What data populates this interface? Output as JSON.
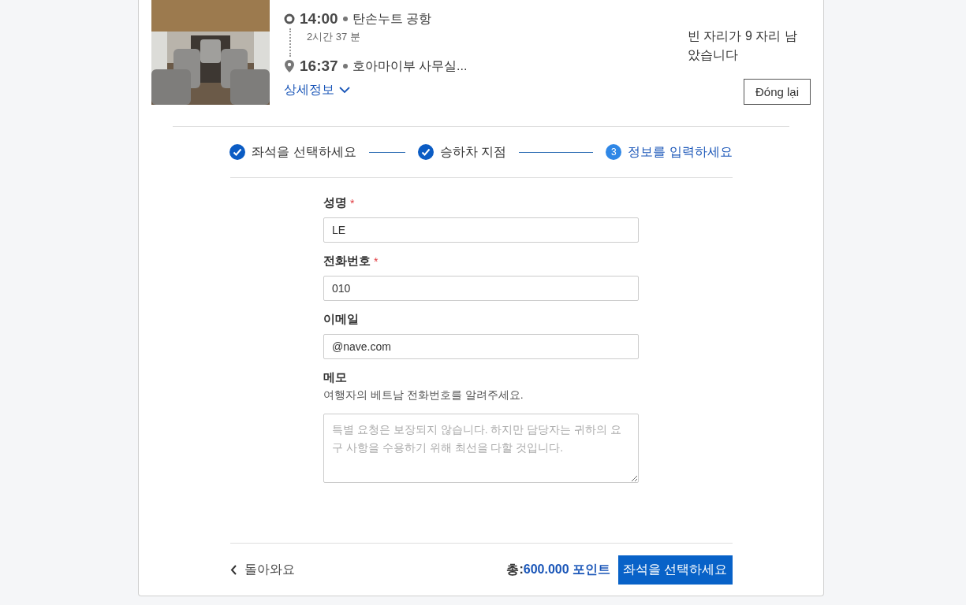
{
  "trip": {
    "departure": {
      "time": "14:00",
      "place": "탄손누트 공항"
    },
    "duration": "2시간 37 분",
    "arrival": {
      "time": "16:37",
      "place": "호아마이부 사무실..."
    },
    "details_link": "상세정보",
    "seats_left": "빈 자리가 9 자리 남았습니다",
    "close_button": "Đóng lại"
  },
  "steps": [
    {
      "label": "좌석을 선택하세요",
      "completed": true
    },
    {
      "label": "승하차 지점",
      "completed": true
    },
    {
      "label": "정보를 입력하세요",
      "number": "3",
      "completed": false
    }
  ],
  "form": {
    "fields": [
      {
        "label": "성명",
        "required_mark": "*",
        "value": "LE"
      },
      {
        "label": "전화번호",
        "required_mark": "*",
        "value": "010"
      },
      {
        "label": "이메일",
        "value": "@nave.com"
      }
    ],
    "memo": {
      "label": "메모",
      "hint": "여행자의 베트남 전화번호를 알려주세요.",
      "placeholder": "특별 요청은 보장되지 않습니다. 하지만 담당자는 귀하의 요구 사항을 수용하기 위해 최선을 다할 것입니다."
    }
  },
  "footer": {
    "back": "돌아와요",
    "total_label": "총:",
    "total_value": "600.000 포인트",
    "next_button": "좌석을 선택하세요"
  }
}
